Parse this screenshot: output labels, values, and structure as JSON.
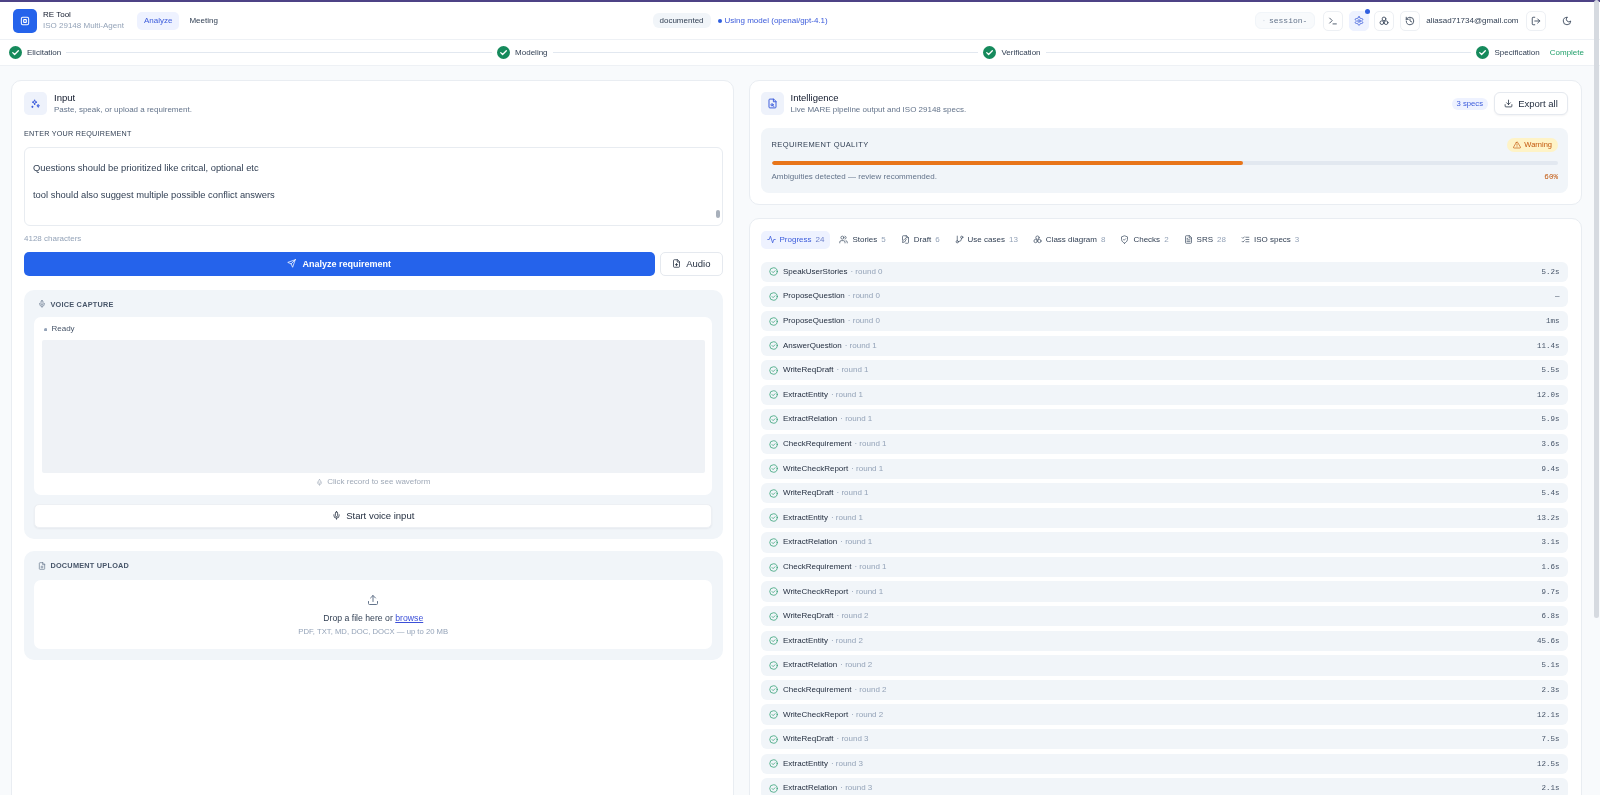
{
  "header": {
    "app_name": "RE Tool",
    "app_subtitle": "ISO 29148 Multi-Agent",
    "nav": [
      {
        "label": "Analyze",
        "selected": true
      },
      {
        "label": "Meeting",
        "selected": false
      }
    ],
    "mode_badge": "documented",
    "model_status": "Using model (openai/gpt-4.1)",
    "session_label": "session-",
    "toolbar": [
      {
        "kind": "terminal",
        "selected": false,
        "notification": false
      },
      {
        "kind": "settings",
        "selected": true,
        "notification": true
      },
      {
        "kind": "network",
        "selected": false,
        "notification": false
      },
      {
        "kind": "history",
        "selected": false,
        "notification": false
      }
    ],
    "user_email": "aliasad71734@gmail.com",
    "actions": [
      {
        "kind": "logout"
      },
      {
        "kind": "theme"
      }
    ]
  },
  "stepper": {
    "steps": [
      {
        "label": "Elicitation",
        "done": true
      },
      {
        "label": "Modeling",
        "done": true
      },
      {
        "label": "Verification",
        "done": true
      },
      {
        "label": "Specification",
        "done": true
      }
    ],
    "status": "Complete"
  },
  "input": {
    "title": "Input",
    "subtitle": "Paste, speak, or upload a requirement.",
    "field_label": "ENTER YOUR REQUIREMENT",
    "requirement_text": "Questions should be prioritized like critcal, optional etc\n\ntool should also suggest multiple possible conflict answers",
    "char_count": "4128 characters",
    "analyze_button": "Analyze requirement",
    "audio_button": "Audio",
    "voice_capture": {
      "title": "VOICE CAPTURE",
      "status": "Ready",
      "hint": "Click record to see waveform",
      "button": "Start voice input"
    },
    "document_upload": {
      "title": "DOCUMENT UPLOAD",
      "drop_text": "Drop a file here or",
      "browse_link": "browse",
      "formats": "PDF, TXT, MD, DOC, DOCX — up to 20 MB"
    }
  },
  "intelligence": {
    "title": "Intelligence",
    "subtitle": "Live MARE pipeline output and ISO 29148 specs.",
    "spec_badge": "3 specs",
    "export_button": "Export all",
    "quality": {
      "label": "REQUIREMENT QUALITY",
      "badge": {
        "kind": "warning",
        "label": "Warning"
      },
      "level": 0.6,
      "note": "Ambiguities detected — review recommended.",
      "percent": "60%"
    }
  },
  "results": {
    "tabs": [
      {
        "kind": "progress",
        "label": "Progress",
        "count": "24",
        "selected": true
      },
      {
        "kind": "stories",
        "label": "Stories",
        "count": "5",
        "selected": false
      },
      {
        "kind": "draft",
        "label": "Draft",
        "count": "6",
        "selected": false
      },
      {
        "kind": "use_cases",
        "label": "Use cases",
        "count": "13",
        "selected": false
      },
      {
        "kind": "class_diagram",
        "label": "Class diagram",
        "count": "8",
        "selected": false
      },
      {
        "kind": "checks",
        "label": "Checks",
        "count": "2",
        "selected": false
      },
      {
        "kind": "srs",
        "label": "SRS",
        "count": "28",
        "selected": false
      },
      {
        "kind": "iso_specs",
        "label": "ISO specs",
        "count": "3",
        "selected": false
      }
    ],
    "rows": [
      {
        "name": "SpeakUserStories",
        "round": "· round 0",
        "time": "5.2s",
        "done": true
      },
      {
        "name": "ProposeQuestion",
        "round": "· round 0",
        "time": "—",
        "done": true
      },
      {
        "name": "ProposeQuestion",
        "round": "· round 0",
        "time": "1ms",
        "done": true
      },
      {
        "name": "AnswerQuestion",
        "round": "· round 1",
        "time": "11.4s",
        "done": true
      },
      {
        "name": "WriteReqDraft",
        "round": "· round 1",
        "time": "5.5s",
        "done": true
      },
      {
        "name": "ExtractEntity",
        "round": "· round 1",
        "time": "12.0s",
        "done": true
      },
      {
        "name": "ExtractRelation",
        "round": "· round 1",
        "time": "5.9s",
        "done": true
      },
      {
        "name": "CheckRequirement",
        "round": "· round 1",
        "time": "3.6s",
        "done": true
      },
      {
        "name": "WriteCheckReport",
        "round": "· round 1",
        "time": "9.4s",
        "done": true
      },
      {
        "name": "WriteReqDraft",
        "round": "· round 1",
        "time": "5.4s",
        "done": true
      },
      {
        "name": "ExtractEntity",
        "round": "· round 1",
        "time": "13.2s",
        "done": true
      },
      {
        "name": "ExtractRelation",
        "round": "· round 1",
        "time": "3.1s",
        "done": true
      },
      {
        "name": "CheckRequirement",
        "round": "· round 1",
        "time": "1.6s",
        "done": true
      },
      {
        "name": "WriteCheckReport",
        "round": "· round 1",
        "time": "9.7s",
        "done": true
      },
      {
        "name": "WriteReqDraft",
        "round": "· round 2",
        "time": "6.8s",
        "done": true
      },
      {
        "name": "ExtractEntity",
        "round": "· round 2",
        "time": "45.6s",
        "done": true
      },
      {
        "name": "ExtractRelation",
        "round": "· round 2",
        "time": "5.1s",
        "done": true
      },
      {
        "name": "CheckRequirement",
        "round": "· round 2",
        "time": "2.3s",
        "done": true
      },
      {
        "name": "WriteCheckReport",
        "round": "· round 2",
        "time": "12.1s",
        "done": true
      },
      {
        "name": "WriteReqDraft",
        "round": "· round 3",
        "time": "7.5s",
        "done": true
      },
      {
        "name": "ExtractEntity",
        "round": "· round 3",
        "time": "12.5s",
        "done": true
      },
      {
        "name": "ExtractRelation",
        "round": "· round 3",
        "time": "2.1s",
        "done": true
      }
    ]
  }
}
